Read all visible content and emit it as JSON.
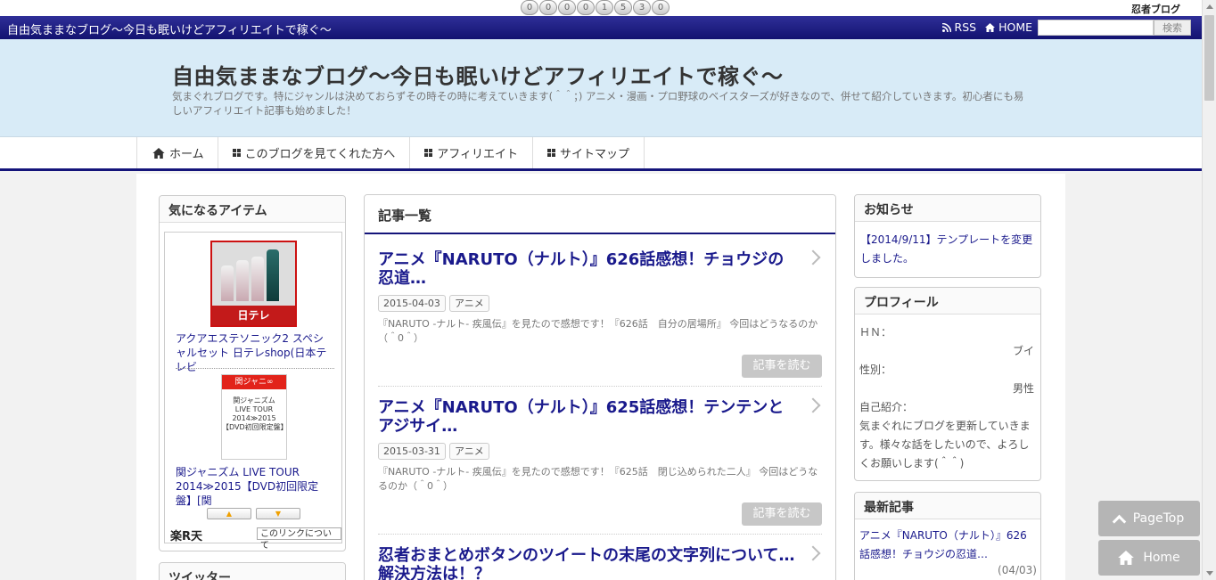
{
  "counter": {
    "digits": [
      "0",
      "0",
      "0",
      "0",
      "1",
      "5",
      "3",
      "0"
    ]
  },
  "ninja_logo": "忍者ブログ",
  "titlebar": {
    "title": "自由気ままなブログ〜今日も眠いけどアフィリエイトで稼ぐ〜",
    "rss": "RSS",
    "home": "HOME",
    "search_button": "検索",
    "search_value": ""
  },
  "header": {
    "title": "自由気ままなブログ〜今日も眠いけどアフィリエイトで稼ぐ〜",
    "description": "気まぐれブログです。特にジャンルは決めておらずその時その時に考えていきます(＾＾；) アニメ・漫画・プロ野球のベイスターズが好きなので、併せて紹介していきます。初心者にも易しいアフィリエイト記事も始めました！"
  },
  "nav": {
    "items": [
      "ホーム",
      "このブログを見てくれた方へ",
      "アフィリエイト",
      "サイトマップ"
    ]
  },
  "sidebar_left": {
    "items_heading": "気になるアイテム",
    "product1_badge": "日テレ",
    "product1_title": "アクアエステソニック2 スペシャルセット 日テレshop(日本テレビ",
    "product2_banner": "関ジャニ∞",
    "product2_lines": [
      "関ジャニズム",
      "LIVE TOUR",
      "2014≫2015",
      "【DVD初回限定盤】"
    ],
    "product2_title": "関ジャニズム LIVE TOUR 2014≫2015【DVD初回限定盤】[関",
    "up_arrow": "▲",
    "down_arrow": "▼",
    "rakuten": "楽R天",
    "link_about": "このリンクについて",
    "twitter_heading": "ツイッター"
  },
  "articles": {
    "heading": "記事一覧",
    "read_more": "記事を読む",
    "list": [
      {
        "title": "アニメ『NARUTO（ナルト）』626話感想！チョウジの忍道…",
        "date": "2015-04-03",
        "category": "アニメ",
        "excerpt": "『NARUTO -ナルト- 疾風伝』を見たので感想です！『626話　自分の居場所』 今回はどうなるのか（＾0＾）"
      },
      {
        "title": "アニメ『NARUTO（ナルト）』625話感想！テンテンとアジサイ…",
        "date": "2015-03-31",
        "category": "アニメ",
        "excerpt": "『NARUTO -ナルト- 疾風伝』を見たので感想です！『625話　閉じ込められた二人』 今回はどうなるのか（＾0＾）"
      },
      {
        "title": "忍者おまとめボタンのツイートの末尾の文字列について…解決方法は！？"
      }
    ]
  },
  "sidebar_right": {
    "notice_heading": "お知らせ",
    "notice_text": "【2014/9/11】テンプレートを変更しました。",
    "profile_heading": "プロフィール",
    "hn_label": "ＨＮ：",
    "hn_value": "ブイ",
    "gender_label": "性別：",
    "gender_value": "男性",
    "intro_label": "自己紹介：",
    "intro_text": "気まぐれにブログを更新していきます。様々な話をしたいので、よろしくお願いします(＾＾)",
    "latest_heading": "最新記事",
    "latest_title": "アニメ『NARUTO（ナルト）』626話感想！チョウジの忍道…",
    "latest_date": "(04/03)"
  },
  "floating": {
    "pagetop": "PageTop",
    "home": "Home"
  }
}
